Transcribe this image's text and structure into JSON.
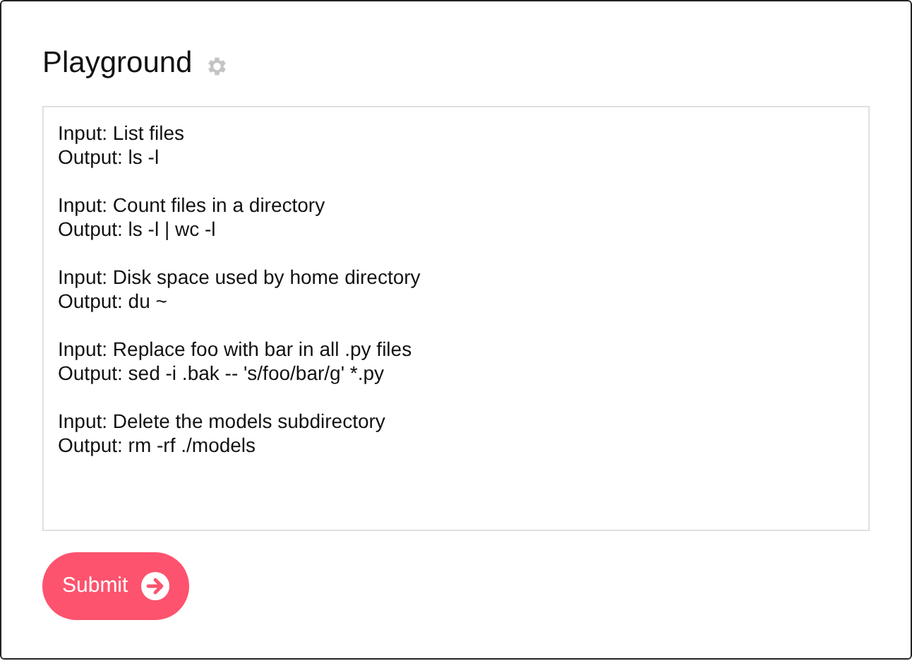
{
  "title": "Playground",
  "prompt": {
    "value": "Input: List files\nOutput: ls -l\n\nInput: Count files in a directory\nOutput: ls -l | wc -l\n\nInput: Disk space used by home directory\nOutput: du ~\n\nInput: Replace foo with bar in all .py files\nOutput: sed -i .bak -- 's/foo/bar/g' *.py\n\nInput: Delete the models subdirectory\nOutput: rm -rf ./models"
  },
  "submit": {
    "label": "Submit"
  }
}
